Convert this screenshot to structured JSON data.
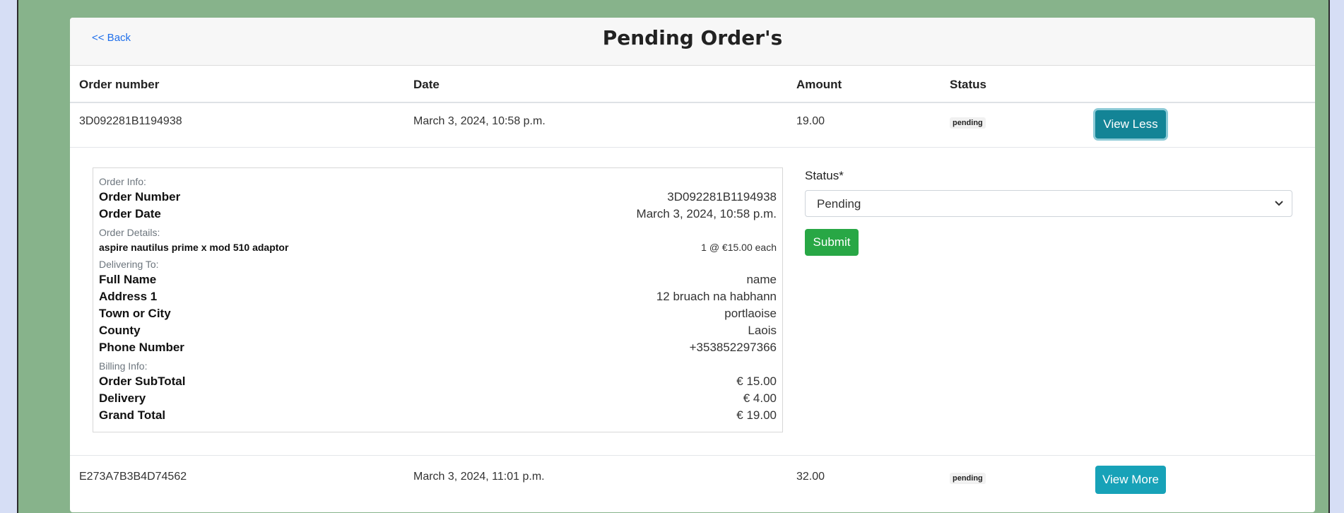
{
  "header": {
    "back_label": "<< Back",
    "title": "Pending Order's"
  },
  "table": {
    "columns": [
      "Order number",
      "Date",
      "Amount",
      "Status"
    ],
    "rows": [
      {
        "order_number": "3D092281B1194938",
        "date": "March 3, 2024, 10:58 p.m.",
        "amount": "19.00",
        "status": "pending",
        "toggle_label": "View Less"
      },
      {
        "order_number": "E273A7B3B4D74562",
        "date": "March 3, 2024, 11:01 p.m.",
        "amount": "32.00",
        "status": "pending",
        "toggle_label": "View More"
      }
    ]
  },
  "details": {
    "order_info_label": "Order Info:",
    "order_number_key": "Order Number",
    "order_number_value": "3D092281B1194938",
    "order_date_key": "Order Date",
    "order_date_value": "March 3, 2024, 10:58 p.m.",
    "order_details_label": "Order Details:",
    "item_name": "aspire nautilus prime x mod 510 adaptor",
    "item_qty_price": "1 @ €15.00 each",
    "delivering_label": "Delivering To:",
    "full_name_key": "Full Name",
    "full_name_value": "name",
    "address1_key": "Address 1",
    "address1_value": "12 bruach na habhann",
    "town_key": "Town or City",
    "town_value": "portlaoise",
    "county_key": "County",
    "county_value": "Laois",
    "phone_key": "Phone Number",
    "phone_value": "+353852297366",
    "billing_label": "Billing Info:",
    "subtotal_key": "Order SubTotal",
    "subtotal_value": "€ 15.00",
    "delivery_key": "Delivery",
    "delivery_value": "€ 4.00",
    "grand_total_key": "Grand Total",
    "grand_total_value": "€ 19.00"
  },
  "status_form": {
    "label": "Status*",
    "selected": "Pending",
    "submit_label": "Submit"
  },
  "colors": {
    "outer_bg": "#87b38b",
    "page_bg": "#d6def5",
    "info_button": "#17a2b8",
    "submit_button": "#28a745",
    "link": "#1f6feb"
  }
}
